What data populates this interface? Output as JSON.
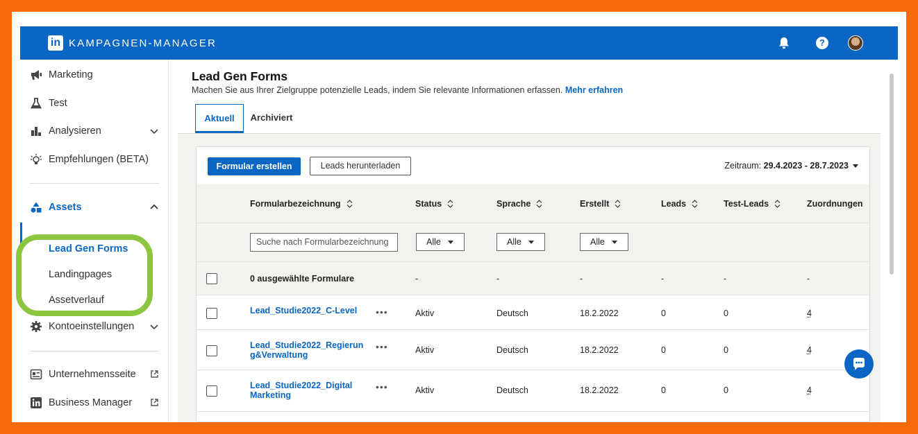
{
  "app": {
    "brand": "KAMPAGNEN-MANAGER",
    "logo_text": "in"
  },
  "header": {
    "help_icon_text": "?"
  },
  "sidebar": {
    "marketing": "Marketing",
    "test": "Test",
    "analysieren": "Analysieren",
    "empfehlungen": "Empfehlungen (BETA)",
    "assets": "Assets",
    "lead_gen_forms": "Lead Gen Forms",
    "landingpages": "Landingpages",
    "assetverlauf": "Assetverlauf",
    "kontoeinstellungen": "Kontoeinstellungen",
    "unternehmensseite": "Unternehmensseite",
    "business_manager": "Business Manager"
  },
  "page": {
    "title": "Lead Gen Forms",
    "description": "Machen Sie aus Ihrer Zielgruppe potenzielle Leads, indem Sie relevante Informationen erfassen.",
    "learn_more": "Mehr erfahren",
    "tabs": {
      "current": "Aktuell",
      "archived": "Archiviert"
    }
  },
  "toolbar": {
    "create_label": "Formular erstellen",
    "download_label": "Leads herunterladen",
    "period_label": "Zeitraum:",
    "period_value": "29.4.2023 - 28.7.2023"
  },
  "table": {
    "headers": {
      "name": "Formularbezeichnung",
      "status": "Status",
      "language": "Sprache",
      "created": "Erstellt",
      "leads": "Leads",
      "test_leads": "Test-Leads",
      "assignments": "Zuordnungen"
    },
    "filters": {
      "search_placeholder": "Suche nach Formularbezeichnung",
      "status": "Alle",
      "language": "Alle",
      "created": "Alle"
    },
    "selection": {
      "label": "0 ausgewählte Formulare",
      "dash": "-"
    },
    "rows": [
      {
        "name": "Lead_Studie2022_C-Level",
        "status": "Aktiv",
        "language": "Deutsch",
        "created": "18.2.2022",
        "leads": "0",
        "test_leads": "0",
        "assignments": "4"
      },
      {
        "name": "Lead_Studie2022_Regierung&Verwaltung",
        "status": "Aktiv",
        "language": "Deutsch",
        "created": "18.2.2022",
        "leads": "0",
        "test_leads": "0",
        "assignments": "4"
      },
      {
        "name": "Lead_Studie2022_Digital Marketing",
        "status": "Aktiv",
        "language": "Deutsch",
        "created": "18.2.2022",
        "leads": "0",
        "test_leads": "0",
        "assignments": "4"
      }
    ],
    "more_label": "•••"
  },
  "colors": {
    "brand": "#0a66c2",
    "frame": "#f66a0a",
    "highlight": "#8cc63f"
  }
}
